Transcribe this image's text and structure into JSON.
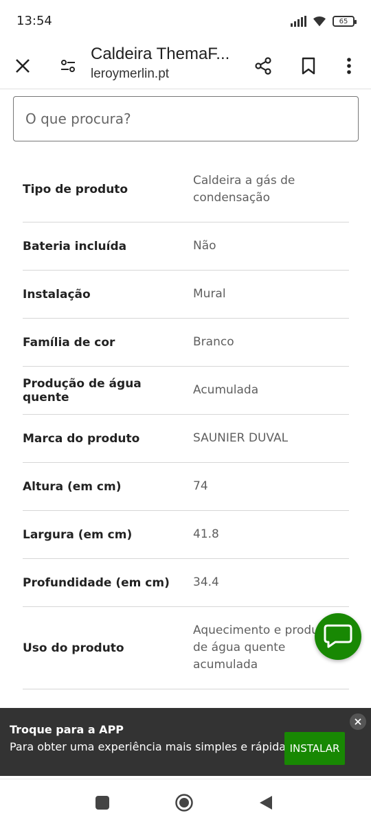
{
  "status_bar": {
    "time": "13:54",
    "battery": "65"
  },
  "toolbar": {
    "title": "Caldeira ThemaF...",
    "url": "leroymerlin.pt"
  },
  "search": {
    "placeholder": "O que procura?"
  },
  "specs": [
    {
      "label": "Tipo de produto",
      "value": "Caldeira a gás de condensação"
    },
    {
      "label": "Bateria incluída",
      "value": "Não"
    },
    {
      "label": "Instalação",
      "value": "Mural"
    },
    {
      "label": "Família de cor",
      "value": "Branco"
    },
    {
      "label": "Produção de água quente",
      "value": "Acumulada"
    },
    {
      "label": "Marca do produto",
      "value": "SAUNIER DUVAL"
    },
    {
      "label": "Altura (em cm)",
      "value": "74"
    },
    {
      "label": "Largura (em cm)",
      "value": "41.8"
    },
    {
      "label": "Profundidade (em cm)",
      "value": "34.4"
    },
    {
      "label": "Uso do produto",
      "value": "Aquecimento e produção de água quente acumulada"
    }
  ],
  "banner": {
    "title": "Troque para a APP",
    "text": "Para obter uma experiência mais simples e rápida",
    "install_label": "INSTALAR"
  },
  "colors": {
    "accent": "#188803",
    "banner_bg": "#333333"
  },
  "icons": [
    "close-icon",
    "tune-icon",
    "share-icon",
    "bookmark-icon",
    "more-vert-icon",
    "chat-icon",
    "recents-icon",
    "home-icon",
    "back-icon"
  ]
}
